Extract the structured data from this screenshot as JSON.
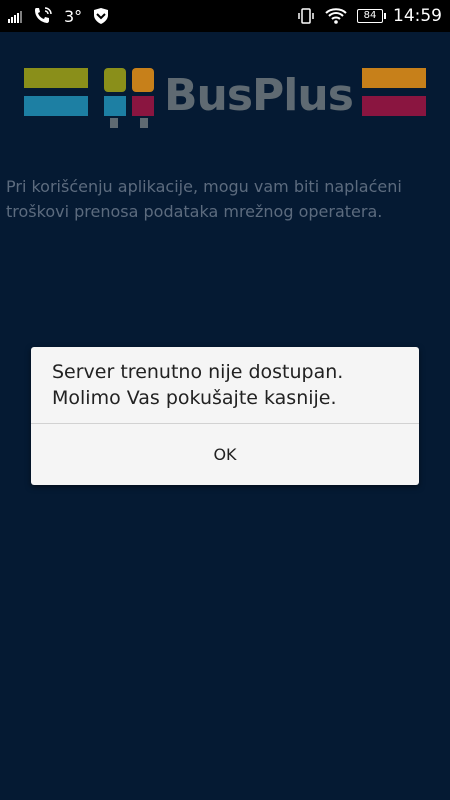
{
  "status_bar": {
    "temperature": "3°",
    "battery_level": "84",
    "time": "14:59",
    "icons": [
      "signal-icon",
      "call-icon",
      "shield-icon",
      "vibrate-icon",
      "wifi-icon",
      "battery-icon"
    ]
  },
  "logo": {
    "text": "BusPlus",
    "colors": {
      "olive": "#8a8f1a",
      "blue": "#1d7fa3",
      "orange": "#c7801a",
      "magenta": "#8a1540",
      "text": "#5f6a72"
    }
  },
  "intro": {
    "text": "Pri korišćenju aplikacije, mogu vam biti naplaćeni troškovi prenosa podataka mrežnog operatera."
  },
  "dialog": {
    "message": "Server trenutno nije dostupan. Molimo Vas pokušajte kasnije.",
    "ok_label": "OK"
  },
  "theme": {
    "background": "#051a33",
    "dialog_bg": "#f5f5f5"
  }
}
